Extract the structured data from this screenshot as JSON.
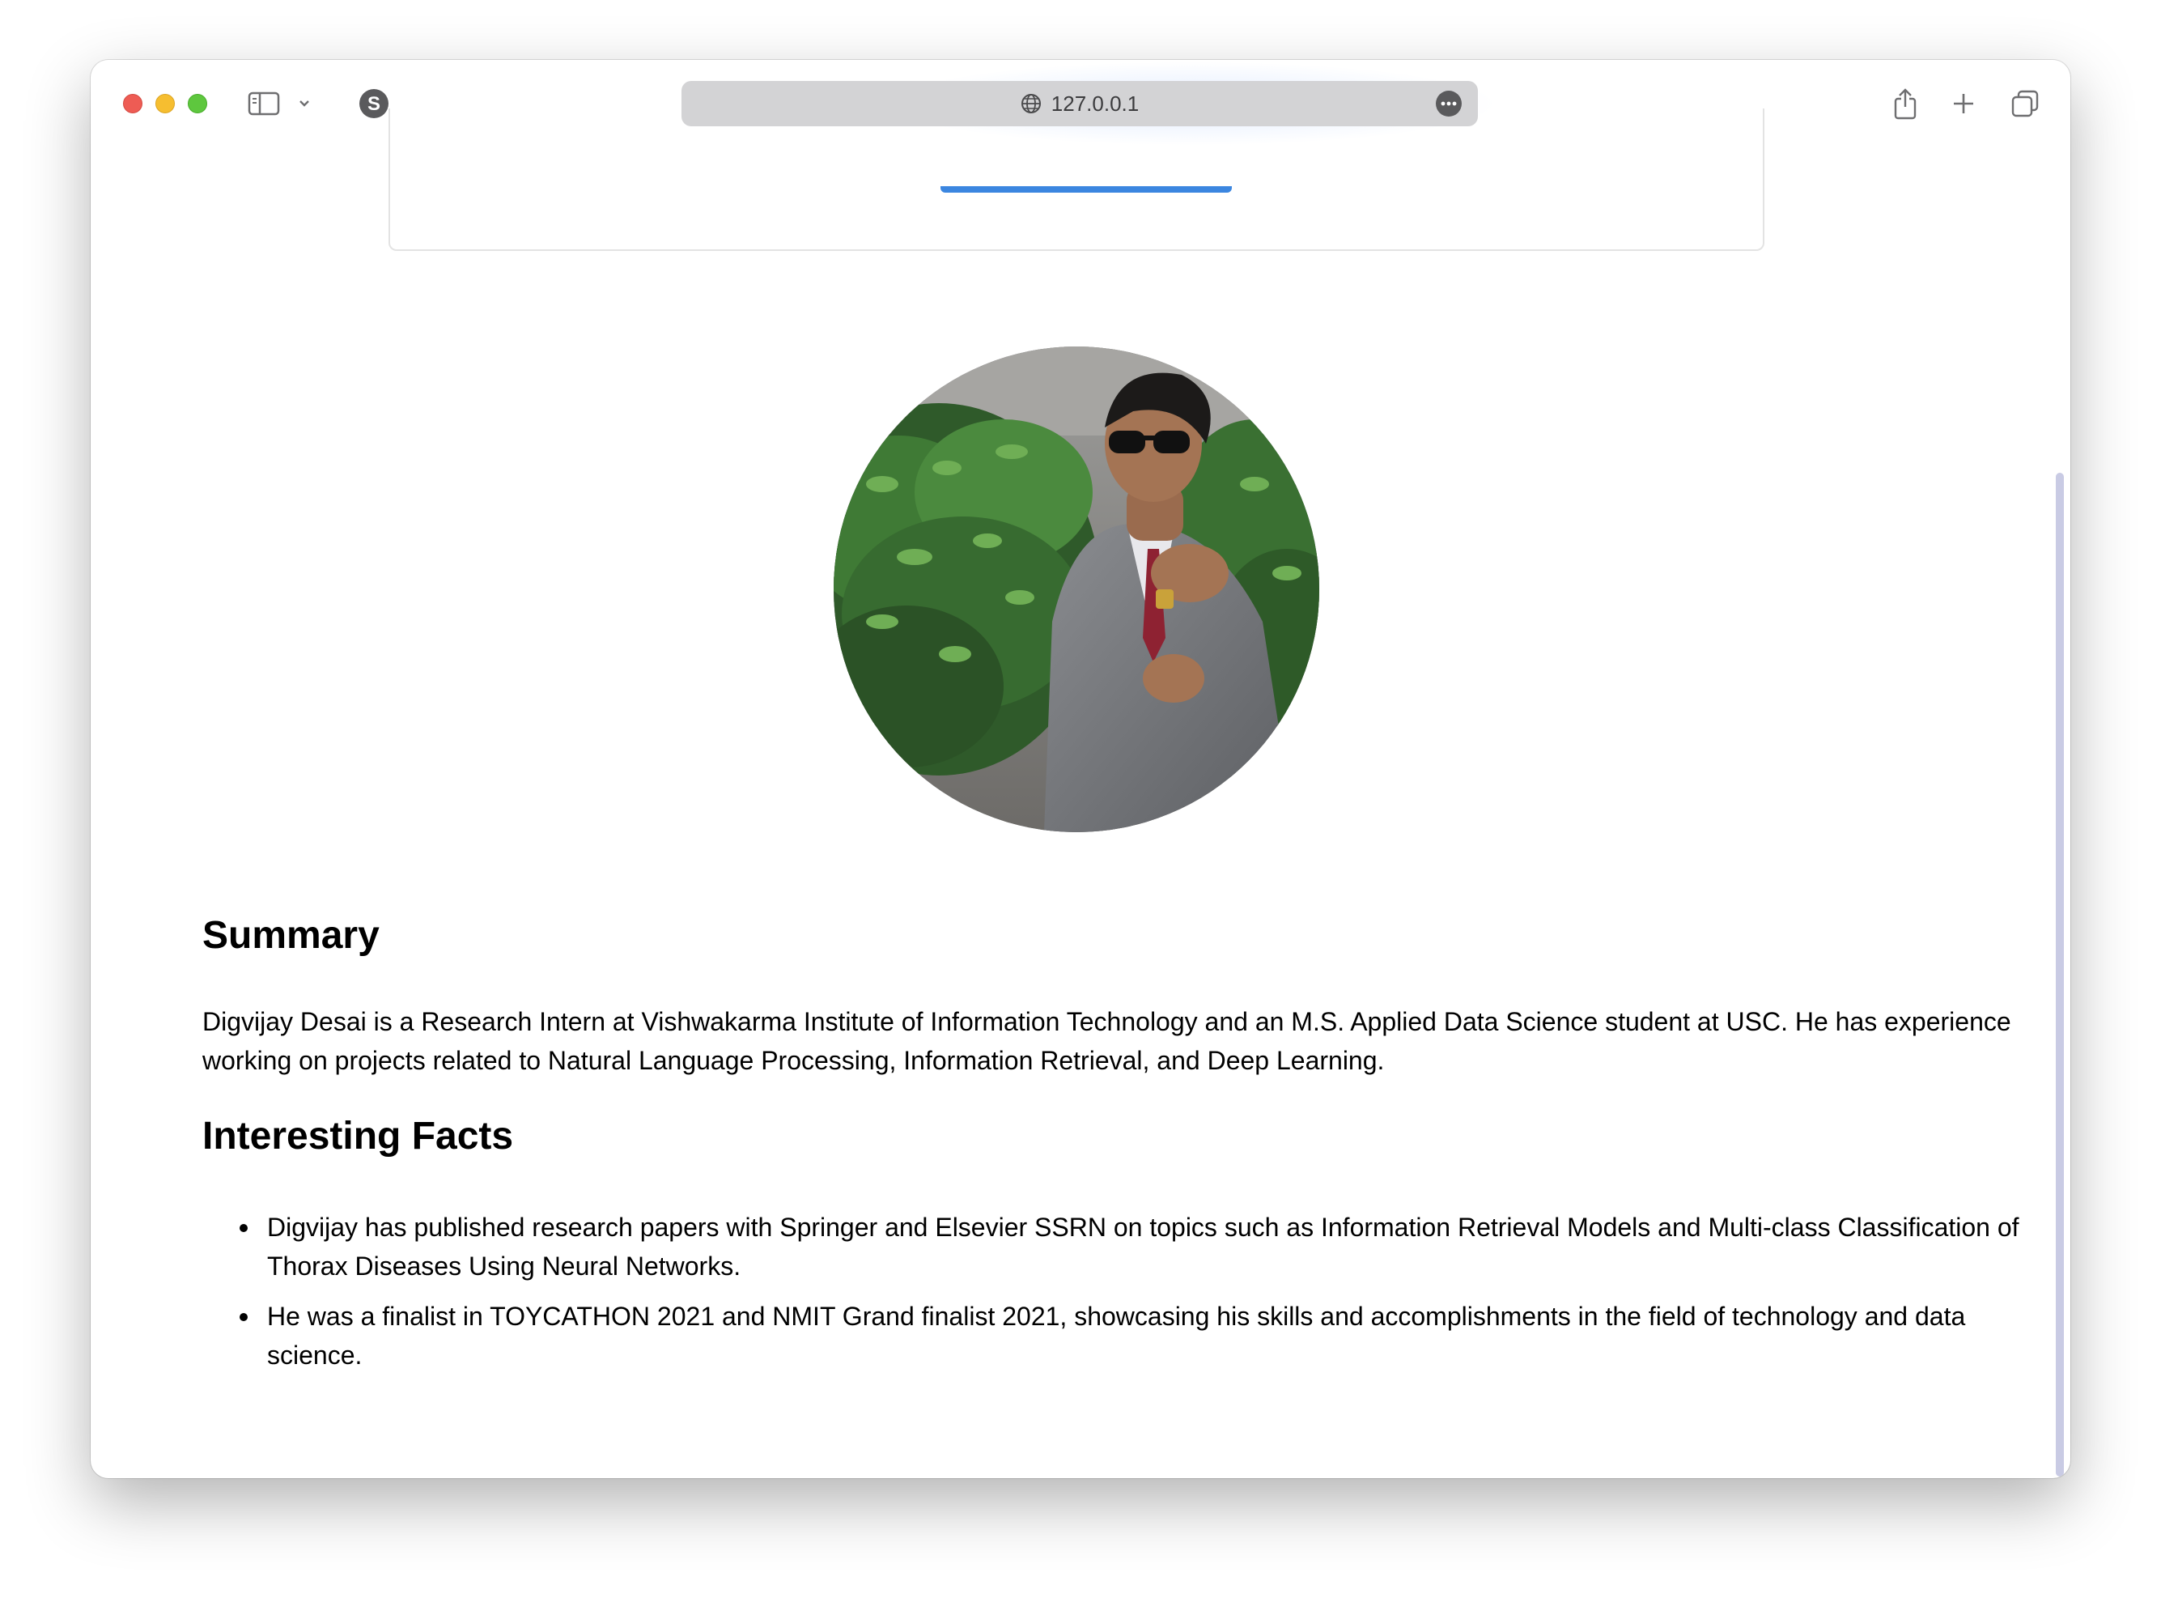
{
  "browser": {
    "url": "127.0.0.1"
  },
  "profile": {
    "photo_alt": "Profile photo"
  },
  "summary": {
    "heading": "Summary",
    "text": "Digvijay Desai is a Research Intern at Vishwakarma Institute of Information Technology and an M.S. Applied Data Science student at USC. He has experience working on projects related to Natural Language Processing, Information Retrieval, and Deep Learning."
  },
  "facts": {
    "heading": "Interesting Facts",
    "items": [
      "Digvijay has published research papers with Springer and Elsevier SSRN on topics such as Information Retrieval Models and Multi-class Classification of Thorax Diseases Using Neural Networks.",
      "He was a finalist in TOYCATHON 2021 and NMIT Grand finalist 2021, showcasing his skills and accomplishments in the field of technology and data science."
    ]
  },
  "colors": {
    "accent_button": "#3b86e0",
    "scrollbar": "#c9cbe4"
  }
}
